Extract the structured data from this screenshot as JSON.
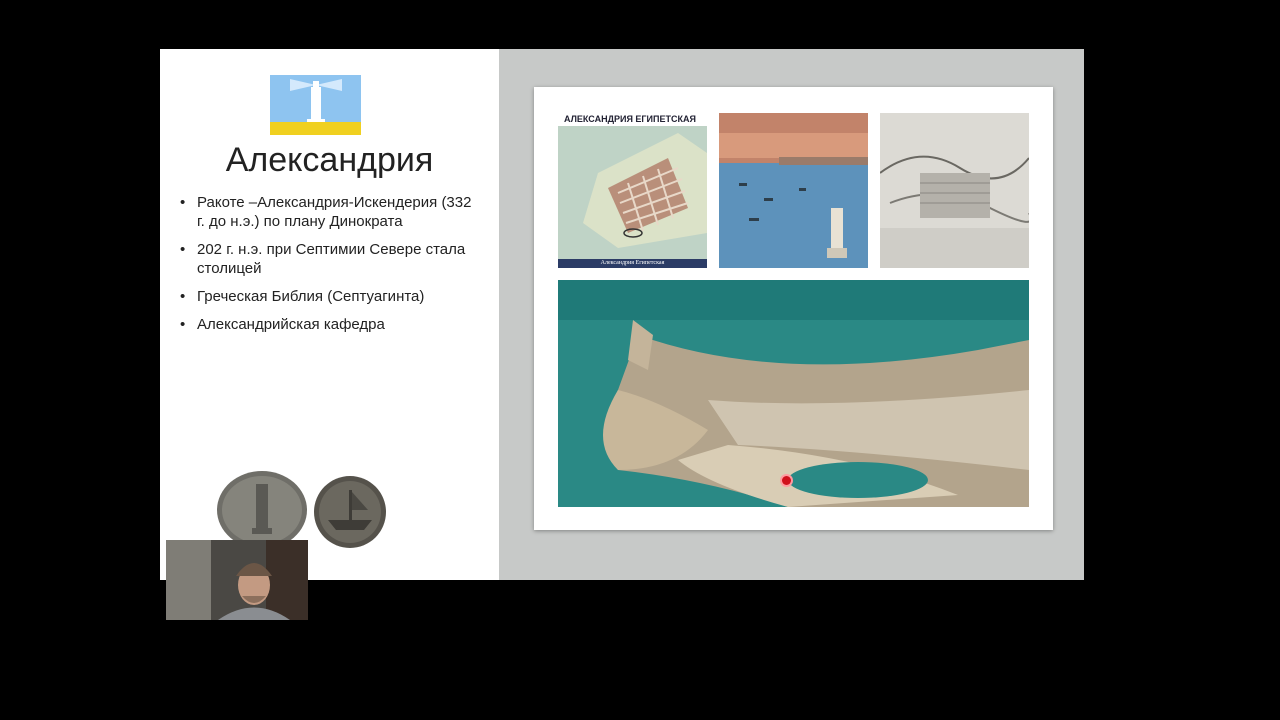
{
  "slide": {
    "title": "Александрия",
    "bullets": [
      "Ракоте –Александрия-Искендерия (332 г. до н.э.) по плану Динократа",
      "202 г. н.э. при Септимии Севере стала столицей",
      "Греческая Библия (Септуагинта)",
      "Александрийская кафедра"
    ],
    "map": {
      "header": "АЛЕКСАНДРИЯ ЕГИПЕТСКАЯ",
      "caption": "Александрия Египетская"
    },
    "colors": {
      "flag_sky": "#8ec4f0",
      "flag_stripe": "#f0d020",
      "right_panel": "#c7c9c8",
      "laser": "#d0101c"
    }
  },
  "icons": {
    "flag": "alexandria-flag-lighthouse",
    "coins": "ancient-coins",
    "pointer": "laser-pointer-dot"
  }
}
